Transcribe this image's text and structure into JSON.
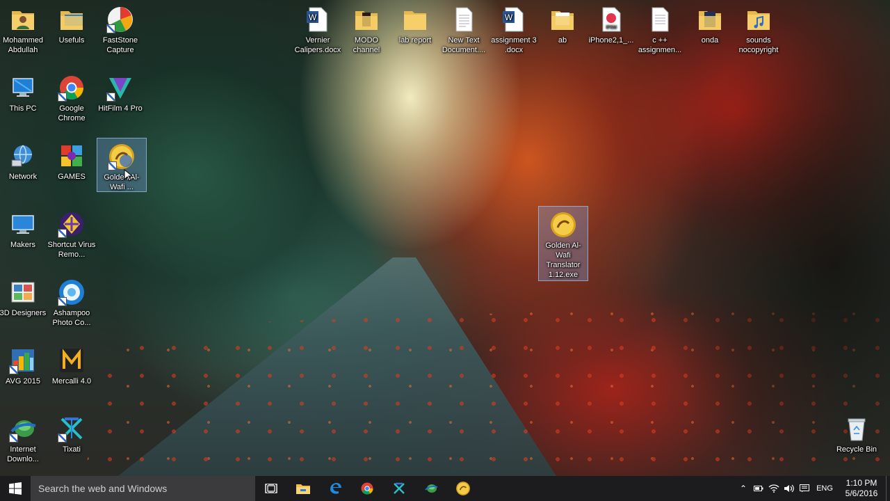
{
  "desktop": {
    "icons": {
      "mohammed": "Mohammed Abdullah",
      "usefuls": "Usefuls",
      "faststone": "FastStone Capture",
      "thispc": "This PC",
      "chrome": "Google Chrome",
      "hitfilm": "HitFilm 4 Pro",
      "network": "Network",
      "games": "GAMES",
      "golden_shortcut": "Golden Al-Wafi ...",
      "makers": "Makers",
      "shortcut_virus": "Shortcut Virus Remo...",
      "designers3d": "3D Designers",
      "ashampoo": "Ashampoo Photo Co...",
      "avg": "AVG 2015",
      "mercalli": "Mercalli 4.0",
      "idm": "Internet Downlo...",
      "tixati": "Tixati",
      "vernier": "Vernier Calipers.docx",
      "modo": "MODO channel",
      "lab_report": "lab report",
      "new_text": "New Text Document....",
      "assignment3": "assignment 3 .docx",
      "ab": "ab",
      "iphone": "iPhone2,1_...",
      "cpp": "c ++ assignmen...",
      "onda": "onda",
      "sounds": "sounds nocopyright",
      "golden_exe": "Golden Al-Wafi Translator 1.12.exe",
      "recycle_bin": "Recycle Bin"
    }
  },
  "taskbar": {
    "search_placeholder": "Search the web and Windows",
    "language": "ENG",
    "time": "1:10 PM",
    "date": "5/6/2016"
  },
  "icon_names": [
    "windows-start-icon",
    "task-view-icon",
    "file-explorer-icon",
    "edge-icon",
    "chrome-icon",
    "tixati-icon",
    "idm-icon",
    "golden-alwafi-icon"
  ],
  "colors": {
    "taskbar_bg": "#1c1c1e",
    "search_bg": "#3b3b3d",
    "selection": "#78a0dc"
  }
}
